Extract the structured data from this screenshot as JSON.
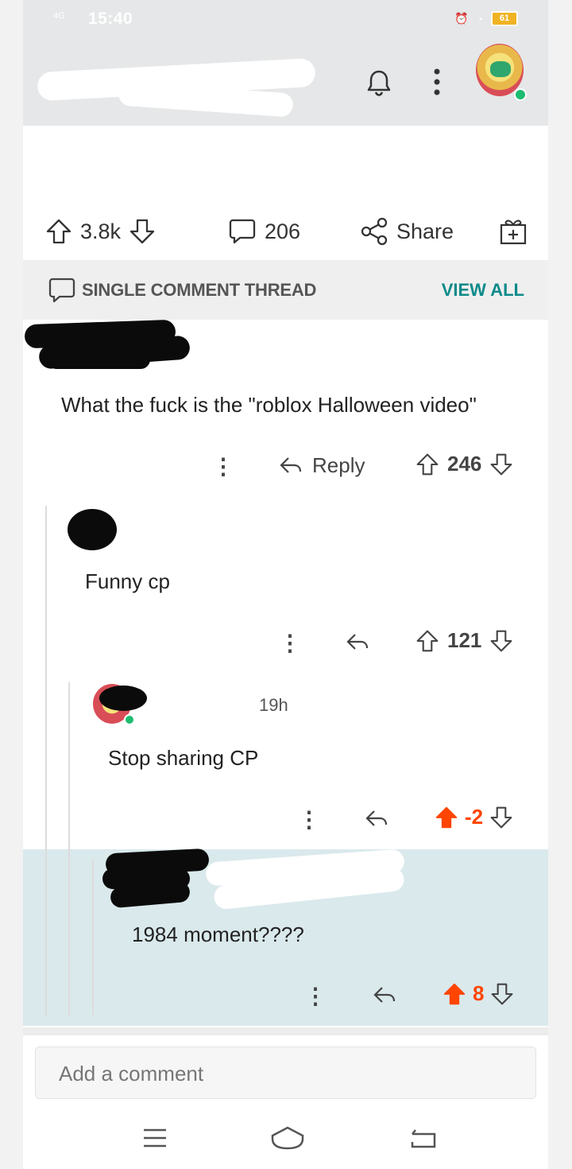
{
  "status_bar": {
    "network": "4G",
    "time": "15:40",
    "battery": "61"
  },
  "post_actions": {
    "upvotes": "3.8k",
    "comments": "206",
    "share_label": "Share"
  },
  "thread_banner": {
    "label": "SINGLE COMMENT THREAD",
    "view_all": "VIEW ALL"
  },
  "comments": [
    {
      "text": "What the fuck is the \"roblox Halloween video\"",
      "reply_label": "Reply",
      "score": "246"
    },
    {
      "text": "Funny cp",
      "score": "121"
    },
    {
      "age": "19h",
      "text": "Stop sharing CP",
      "score": "-2"
    },
    {
      "text": "1984 moment????",
      "score": "8"
    }
  ],
  "composer": {
    "placeholder": "Add a comment"
  },
  "colors": {
    "accent_teal": "#0d8a8a",
    "upvoted_orange": "#ff4500",
    "highlight_bg": "#dae9ec"
  }
}
